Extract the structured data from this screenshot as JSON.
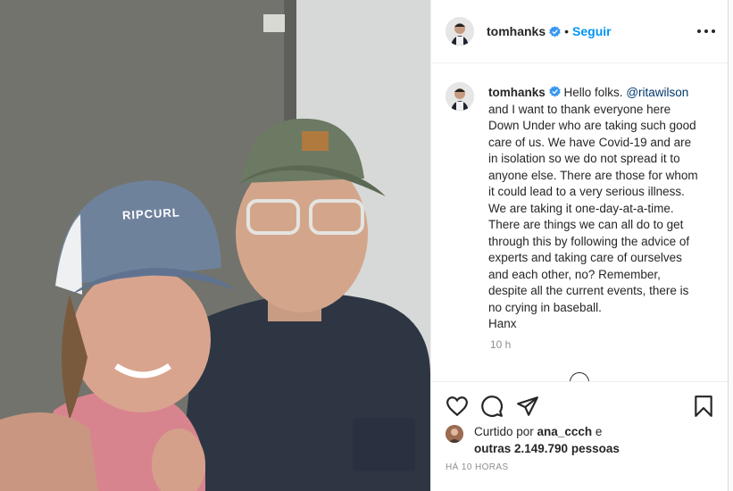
{
  "post": {
    "username": "tomhanks",
    "verified": true,
    "separator": "•",
    "follow_label": "Seguir",
    "more_icon": "more-horizontal-icon",
    "photo_brand_text": "RIPCURL"
  },
  "caption": {
    "username": "tomhanks",
    "mention": "@ritawilson",
    "text_before": "Hello folks. ",
    "text_after": "and I want to thank everyone here Down Under who are taking such good care of us. We have Covid-19 and are in isolation so we do not spread it to anyone else. There are those for whom it could lead to a very serious illness. We are taking it one-day-at-a-time. There are things we can all do to get through this by following the advice of experts and taking care of ourselves and each other, no? Remember, despite all the current events, there is no crying in baseball.\nHanx",
    "time_ago": "10 h"
  },
  "actions": {
    "like_icon": "heart-icon",
    "comment_icon": "comment-icon",
    "share_icon": "paper-plane-icon",
    "save_icon": "bookmark-icon"
  },
  "likes": {
    "prefix": "Curtido por ",
    "first_user": "ana_ccch",
    "conjunction": " e",
    "others_label": "outras 2.149.790 pessoas"
  },
  "timestamp": "HÁ 10 HORAS",
  "colors": {
    "link_blue": "#0095f6",
    "mention_blue": "#00376b",
    "muted_gray": "#8e8e8e",
    "text_dark": "#262626",
    "border": "#efefef"
  }
}
